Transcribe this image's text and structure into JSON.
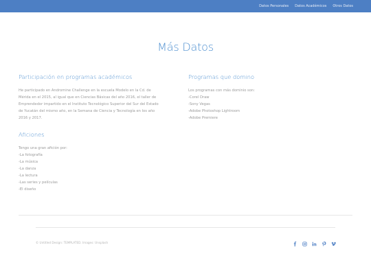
{
  "nav": {
    "links": [
      "Datos Personales",
      "Datos Académicos",
      "Otros Datos"
    ]
  },
  "page": {
    "title": "Más Datos"
  },
  "academic": {
    "title": "Participación en programas académicos",
    "lines": [
      "He participado en Andromine Challenge en la escuela Modelo en la Cd. de",
      "Mérida en el 2015, al igual que en Ciencias Básicas del año 2016, el taller de",
      "Emprendedor impartido en el Instituto Tecnológico Superior del Sur del Estado",
      "de Yucatán del mismo año, en la Semana de Ciencia y Tecnología en los año",
      "2016 y 2017."
    ]
  },
  "programs": {
    "title": "Programas que domino",
    "intro": "Los programas con más dominio son:",
    "items": [
      "-Corel Draw",
      "-Sony Vegas",
      "-Adobe Photoshop Lightroom",
      "-Adobe Premiere"
    ]
  },
  "hobbies": {
    "title": "Aficiones",
    "intro": "Tengo una gran afición por:",
    "items": [
      "-La fotografía",
      "-La música",
      "-La danza",
      "-La lectura",
      "-Las series y películas",
      "-El diseño"
    ]
  },
  "footer": {
    "copyright": "© Untitled Design: TEMPLATED. Images: Unsplash",
    "social": [
      "facebook-icon",
      "instagram-icon",
      "linkedin-icon",
      "pinterest-icon",
      "vimeo-icon"
    ],
    "icon_color": "#4d7fc4"
  },
  "colors": {
    "nav_bg": "#4d7fc4",
    "accent": "#4d8fd0",
    "text": "#9a9a9a"
  }
}
